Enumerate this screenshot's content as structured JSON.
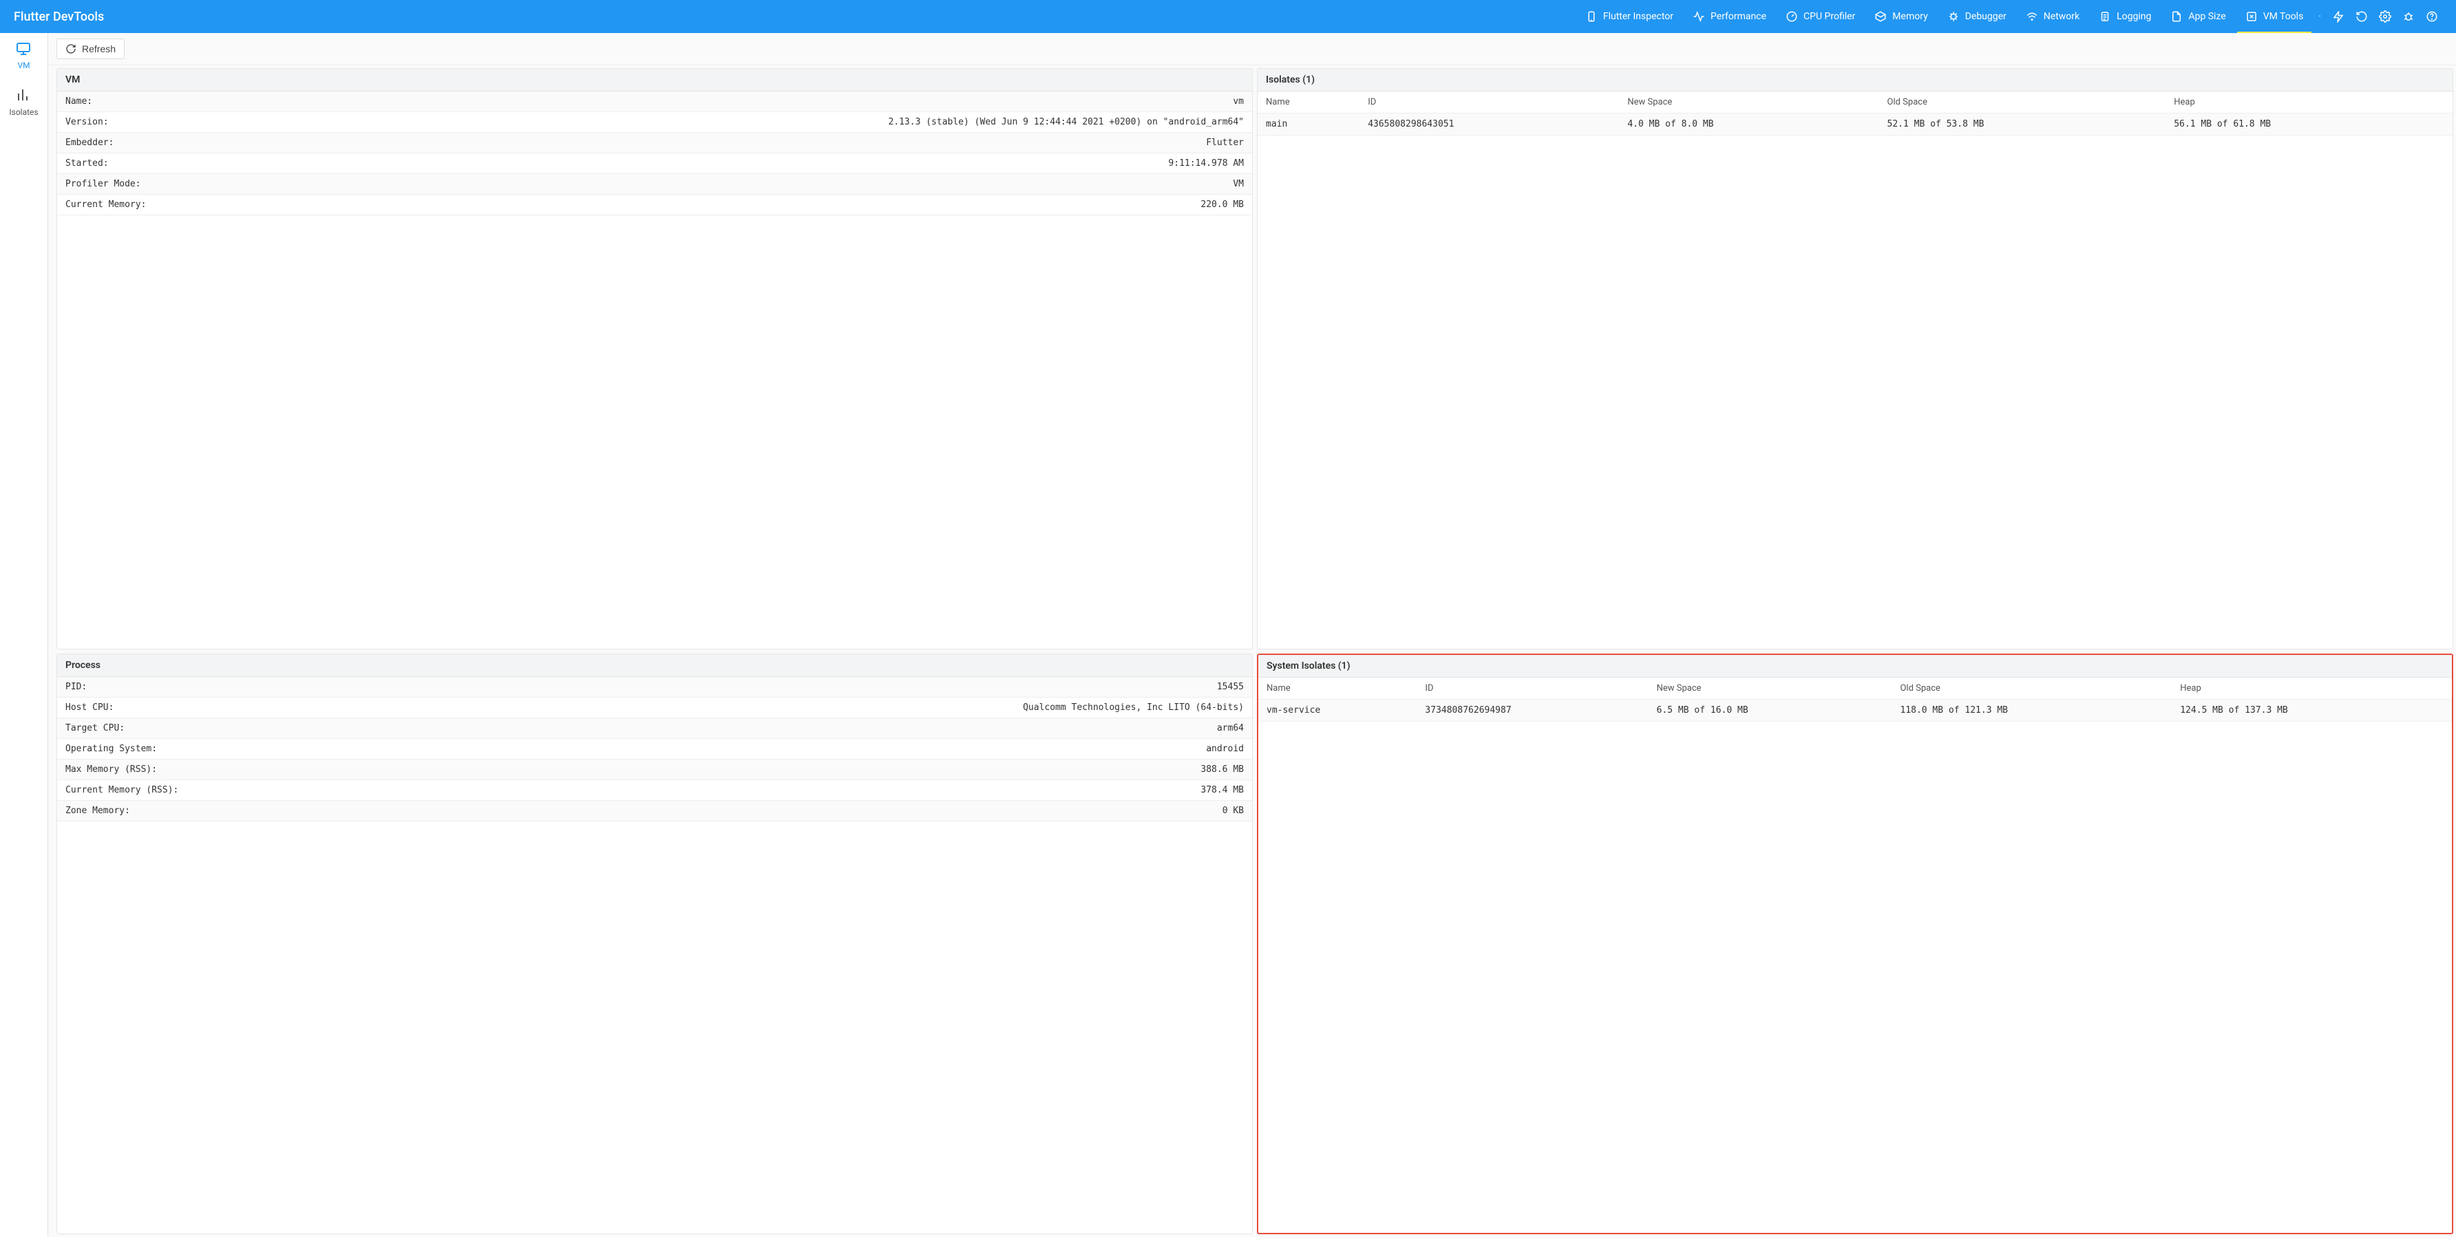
{
  "app_title": "Flutter DevTools",
  "top_tabs": [
    {
      "label": "Flutter Inspector"
    },
    {
      "label": "Performance"
    },
    {
      "label": "CPU Profiler"
    },
    {
      "label": "Memory"
    },
    {
      "label": "Debugger"
    },
    {
      "label": "Network"
    },
    {
      "label": "Logging"
    },
    {
      "label": "App Size"
    },
    {
      "label": "VM Tools"
    }
  ],
  "sidebar": {
    "items": [
      {
        "label": "VM"
      },
      {
        "label": "Isolates"
      }
    ]
  },
  "toolbar": {
    "refresh_label": "Refresh"
  },
  "vm_panel": {
    "title": "VM",
    "rows": [
      {
        "k": "Name:",
        "v": "vm"
      },
      {
        "k": "Version:",
        "v": "2.13.3 (stable) (Wed Jun 9 12:44:44 2021 +0200) on \"android_arm64\""
      },
      {
        "k": "Embedder:",
        "v": "Flutter"
      },
      {
        "k": "Started:",
        "v": "9:11:14.978 AM"
      },
      {
        "k": "Profiler Mode:",
        "v": "VM"
      },
      {
        "k": "Current Memory:",
        "v": "220.0 MB"
      }
    ]
  },
  "process_panel": {
    "title": "Process",
    "rows": [
      {
        "k": "PID:",
        "v": "15455"
      },
      {
        "k": "Host CPU:",
        "v": "Qualcomm Technologies, Inc LITO (64-bits)"
      },
      {
        "k": "Target CPU:",
        "v": "arm64"
      },
      {
        "k": "Operating System:",
        "v": "android"
      },
      {
        "k": "Max Memory (RSS):",
        "v": "388.6 MB"
      },
      {
        "k": "Current Memory (RSS):",
        "v": "378.4 MB"
      },
      {
        "k": "Zone Memory:",
        "v": "0 KB"
      }
    ]
  },
  "isolates_panel": {
    "title": "Isolates (1)",
    "columns": [
      "Name",
      "ID",
      "New Space",
      "Old Space",
      "Heap"
    ],
    "rows": [
      {
        "name": "main",
        "id": "4365808298643051",
        "new": "4.0 MB of 8.0 MB",
        "old": "52.1 MB of 53.8 MB",
        "heap": "56.1 MB of 61.8 MB"
      }
    ]
  },
  "system_isolates_panel": {
    "title": "System Isolates (1)",
    "columns": [
      "Name",
      "ID",
      "New Space",
      "Old Space",
      "Heap"
    ],
    "rows": [
      {
        "name": "vm-service",
        "id": "3734808762694987",
        "new": "6.5 MB of 16.0 MB",
        "old": "118.0 MB of 121.3 MB",
        "heap": "124.5 MB of 137.3 MB"
      }
    ]
  }
}
